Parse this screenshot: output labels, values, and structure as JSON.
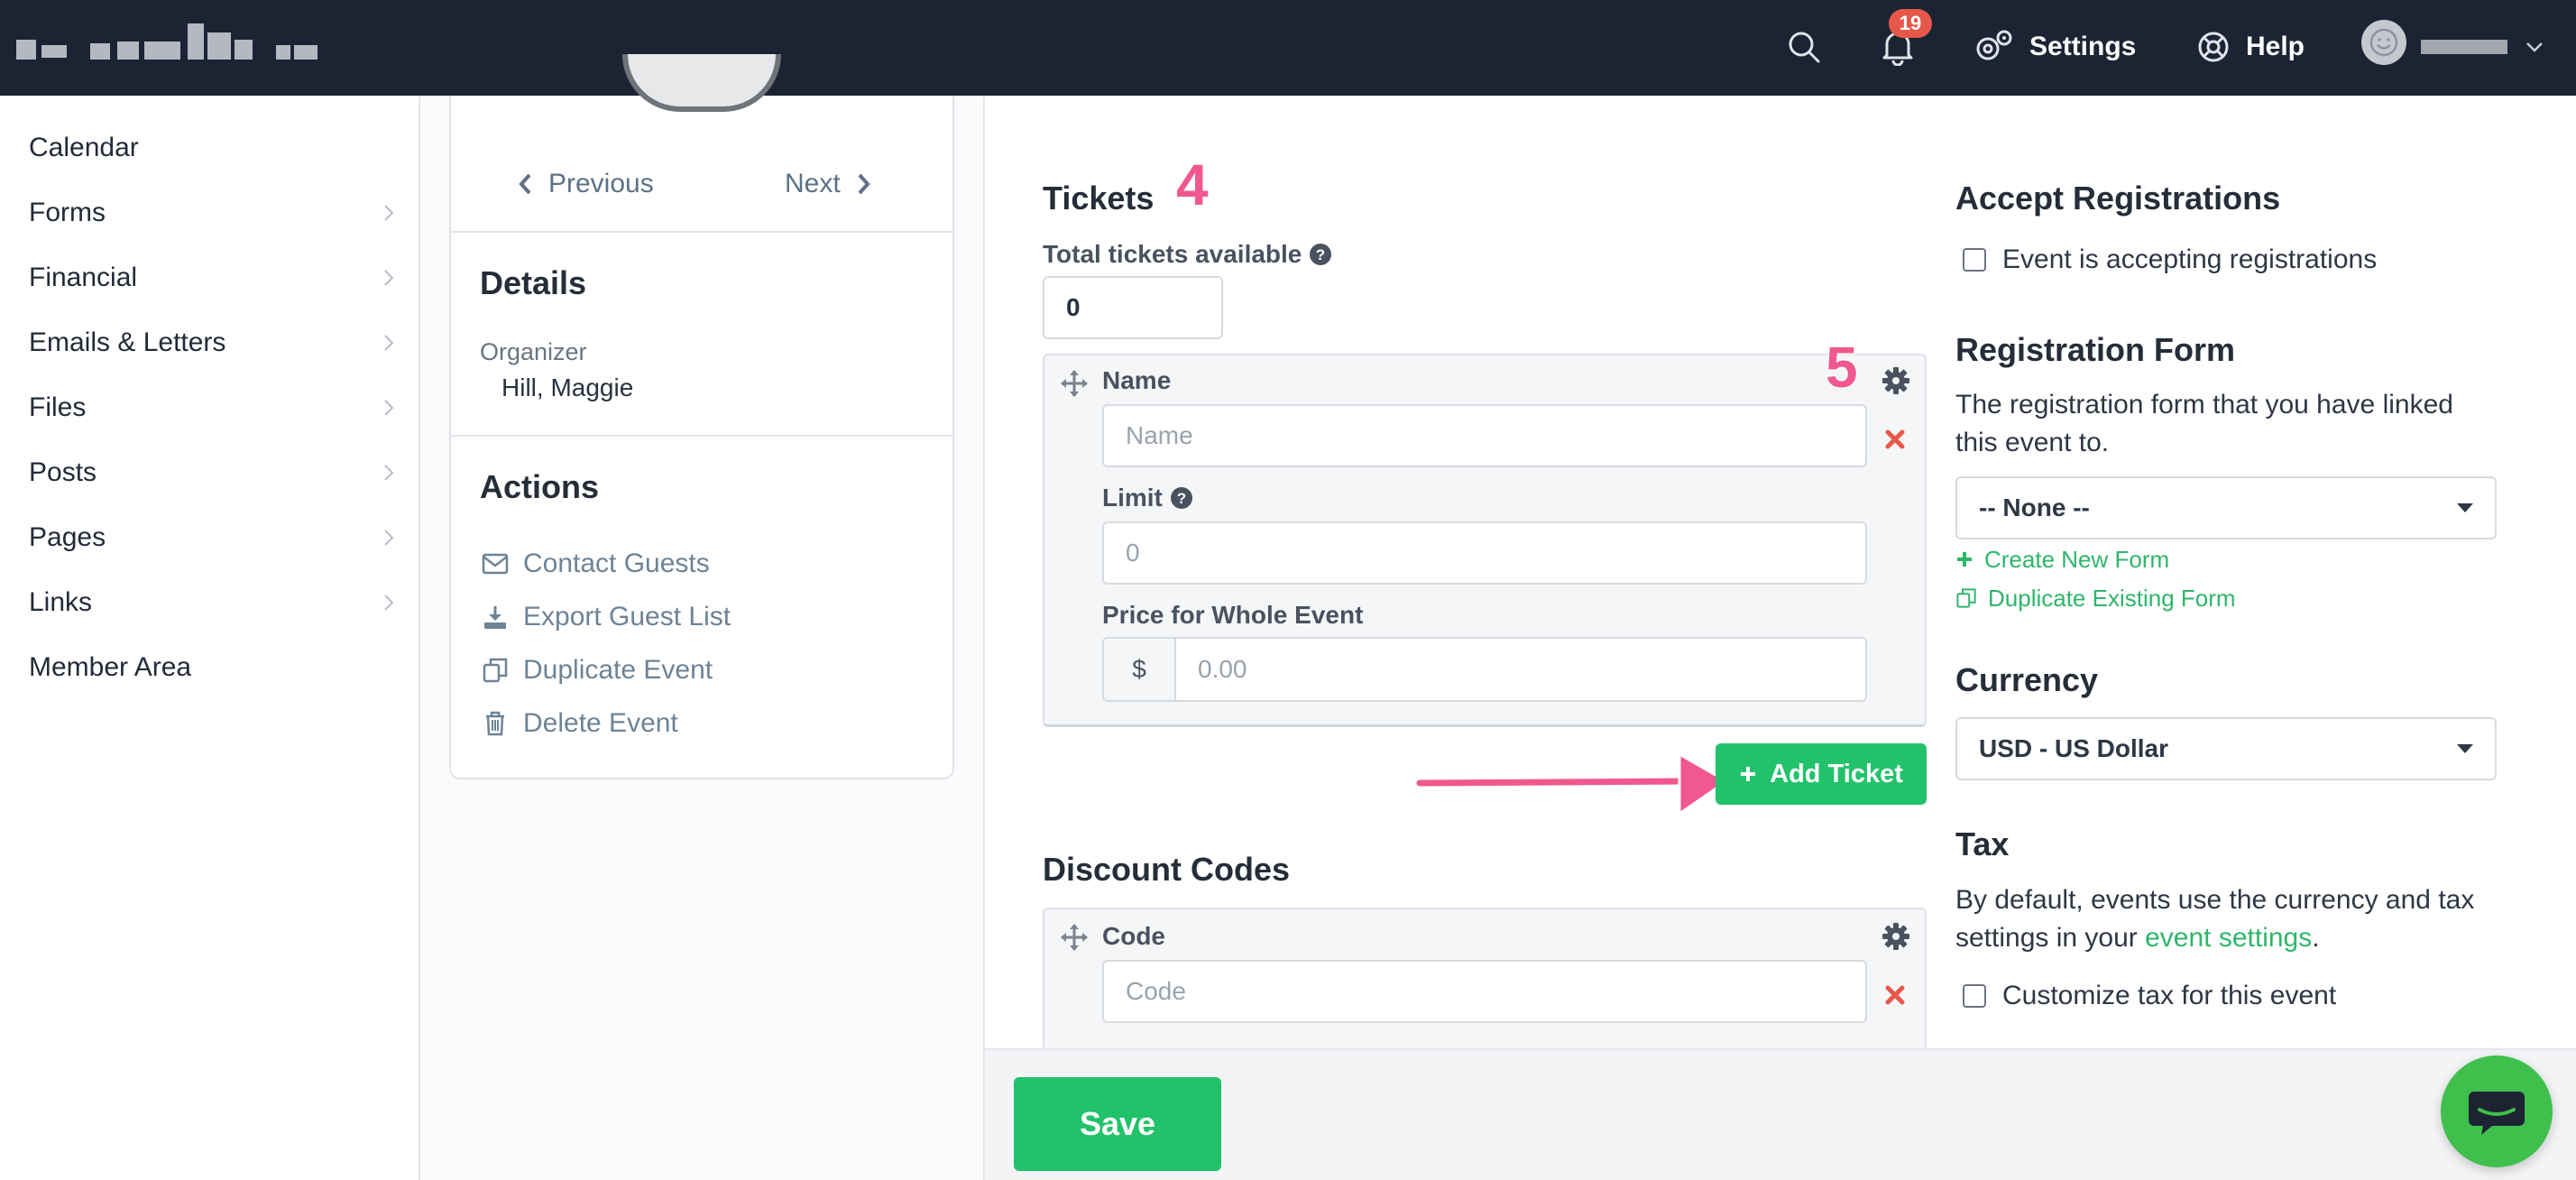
{
  "topbar": {
    "notification_count": "19",
    "settings_label": "Settings",
    "help_label": "Help"
  },
  "sidebar": {
    "items": [
      {
        "label": "Calendar",
        "has_children": false
      },
      {
        "label": "Forms",
        "has_children": true
      },
      {
        "label": "Financial",
        "has_children": true
      },
      {
        "label": "Emails & Letters",
        "has_children": true
      },
      {
        "label": "Files",
        "has_children": true
      },
      {
        "label": "Posts",
        "has_children": true
      },
      {
        "label": "Pages",
        "has_children": true
      },
      {
        "label": "Links",
        "has_children": true
      },
      {
        "label": "Member Area",
        "has_children": false
      }
    ]
  },
  "event_card": {
    "previous_label": "Previous",
    "next_label": "Next",
    "details_heading": "Details",
    "organizer_label": "Organizer",
    "organizer_name": "Hill, Maggie",
    "actions_heading": "Actions",
    "actions": [
      {
        "label": "Contact Guests",
        "icon": "envelope-icon"
      },
      {
        "label": "Export Guest List",
        "icon": "download-icon"
      },
      {
        "label": "Duplicate Event",
        "icon": "copy-icon"
      },
      {
        "label": "Delete Event",
        "icon": "trash-icon"
      }
    ]
  },
  "tickets": {
    "heading": "Tickets",
    "total_label": "Total tickets available",
    "total_value": "0",
    "ticket": {
      "name_label": "Name",
      "name_placeholder": "Name",
      "limit_label": "Limit",
      "limit_placeholder": "0",
      "price_label": "Price for Whole Event",
      "currency_symbol": "$",
      "price_placeholder": "0.00"
    },
    "add_ticket_label": "Add Ticket"
  },
  "discount_codes": {
    "heading": "Discount Codes",
    "code_label": "Code",
    "code_placeholder": "Code"
  },
  "annotations": {
    "step4": "4",
    "step5": "5"
  },
  "save_label": "Save",
  "accept_registrations": {
    "heading": "Accept Registrations",
    "checkbox_label": "Event is accepting registrations"
  },
  "registration_form": {
    "heading": "Registration Form",
    "description": "The registration form that you have linked this event to.",
    "selected": "-- None --",
    "create_link": "Create New Form",
    "duplicate_link": "Duplicate Existing Form"
  },
  "currency": {
    "heading": "Currency",
    "selected": "USD - US Dollar"
  },
  "tax": {
    "heading": "Tax",
    "description_prefix": "By default, events use the currency and tax settings in your ",
    "link_text": "event settings",
    "description_suffix": ".",
    "checkbox_label": "Customize tax for this event"
  },
  "colors": {
    "topbar": "#1c2333",
    "accent_green": "#22c26b",
    "annotation_pink": "#f0588f",
    "danger": "#e8584a"
  }
}
